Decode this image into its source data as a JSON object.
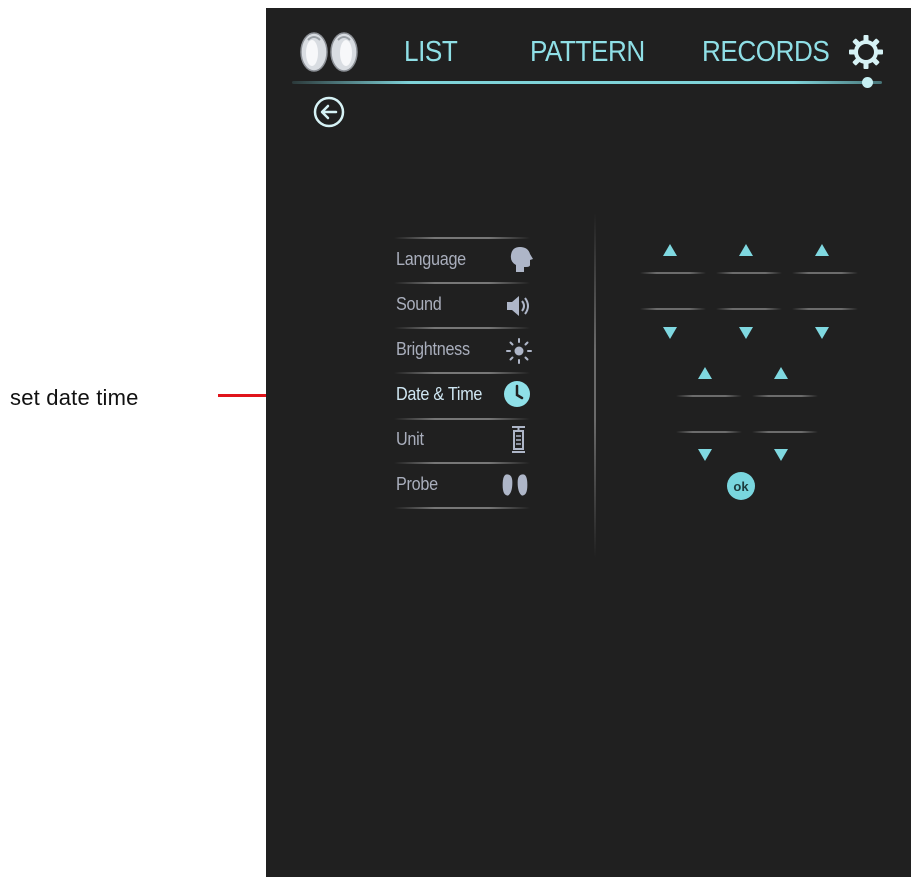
{
  "annotation": {
    "text": "set date time",
    "line_color": "#e0141b"
  },
  "header": {
    "tabs": [
      {
        "label": "LIST"
      },
      {
        "label": "PATTERN"
      },
      {
        "label": "RECORDS"
      }
    ],
    "logo_icon": "probe-pair-icon",
    "settings_icon": "gear-icon",
    "back_icon": "back-arrow-circle-icon"
  },
  "settings_menu": {
    "items": [
      {
        "label": "Language",
        "icon": "head-profile-icon",
        "active": false
      },
      {
        "label": "Sound",
        "icon": "speaker-icon",
        "active": false
      },
      {
        "label": "Brightness",
        "icon": "sun-icon",
        "active": false
      },
      {
        "label": "Date & Time",
        "icon": "clock-icon",
        "active": true
      },
      {
        "label": "Unit",
        "icon": "ruler-icon",
        "active": false
      },
      {
        "label": "Probe",
        "icon": "footprints-icon",
        "active": false
      }
    ]
  },
  "date_time_picker": {
    "ok_label": "ok",
    "date_fields": 3,
    "time_fields": 2
  },
  "colors": {
    "accent": "#7fd3d9",
    "background": "#202020",
    "menu_text": "#a9aebc"
  }
}
